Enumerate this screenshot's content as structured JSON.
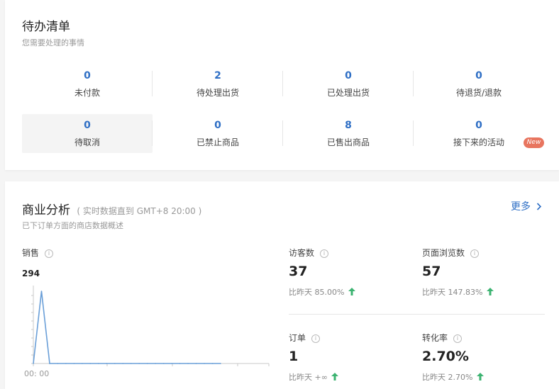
{
  "todo": {
    "title": "待办清单",
    "subtitle": "您需要处理的事情",
    "items": [
      {
        "value": "0",
        "label": "未付款"
      },
      {
        "value": "2",
        "label": "待处理出货"
      },
      {
        "value": "0",
        "label": "已处理出货"
      },
      {
        "value": "0",
        "label": "待退货/退款"
      },
      {
        "value": "0",
        "label": "待取消"
      },
      {
        "value": "0",
        "label": "已禁止商品"
      },
      {
        "value": "8",
        "label": "已售出商品"
      },
      {
        "value": "0",
        "label": "接下来的活动"
      }
    ],
    "new_badge": "New"
  },
  "biz": {
    "title": "商业分析",
    "title_note": "( 实时数据直到 GMT+8 20:00 )",
    "subtitle": "已下订单方面的商店数据概述",
    "more_label": "更多",
    "sales": {
      "label": "销售",
      "value": "294",
      "time_label": "00: 00"
    },
    "metrics": [
      {
        "label": "访客数",
        "value": "37",
        "cmp_prefix": "比昨天",
        "cmp_value": "85.00%"
      },
      {
        "label": "页面浏览数",
        "value": "57",
        "cmp_prefix": "比昨天",
        "cmp_value": "147.83%"
      },
      {
        "label": "订单",
        "value": "1",
        "cmp_prefix": "比昨天",
        "cmp_value": "+∞"
      },
      {
        "label": "转化率",
        "value": "2.70%",
        "cmp_prefix": "比昨天",
        "cmp_value": "2.70%"
      }
    ]
  },
  "chart_data": {
    "type": "line",
    "series": [
      {
        "values": [
          0,
          294,
          0,
          0,
          0,
          0,
          0,
          0,
          0,
          0,
          0,
          0,
          0,
          0,
          0,
          0,
          0,
          0,
          0,
          0,
          0,
          0,
          0,
          0
        ]
      }
    ],
    "ylim": [
      0,
      294
    ]
  },
  "colors": {
    "accent": "#2f6fc5",
    "up": "#3cb371",
    "badge": "#e8755f",
    "line": "#6a9fd8"
  }
}
